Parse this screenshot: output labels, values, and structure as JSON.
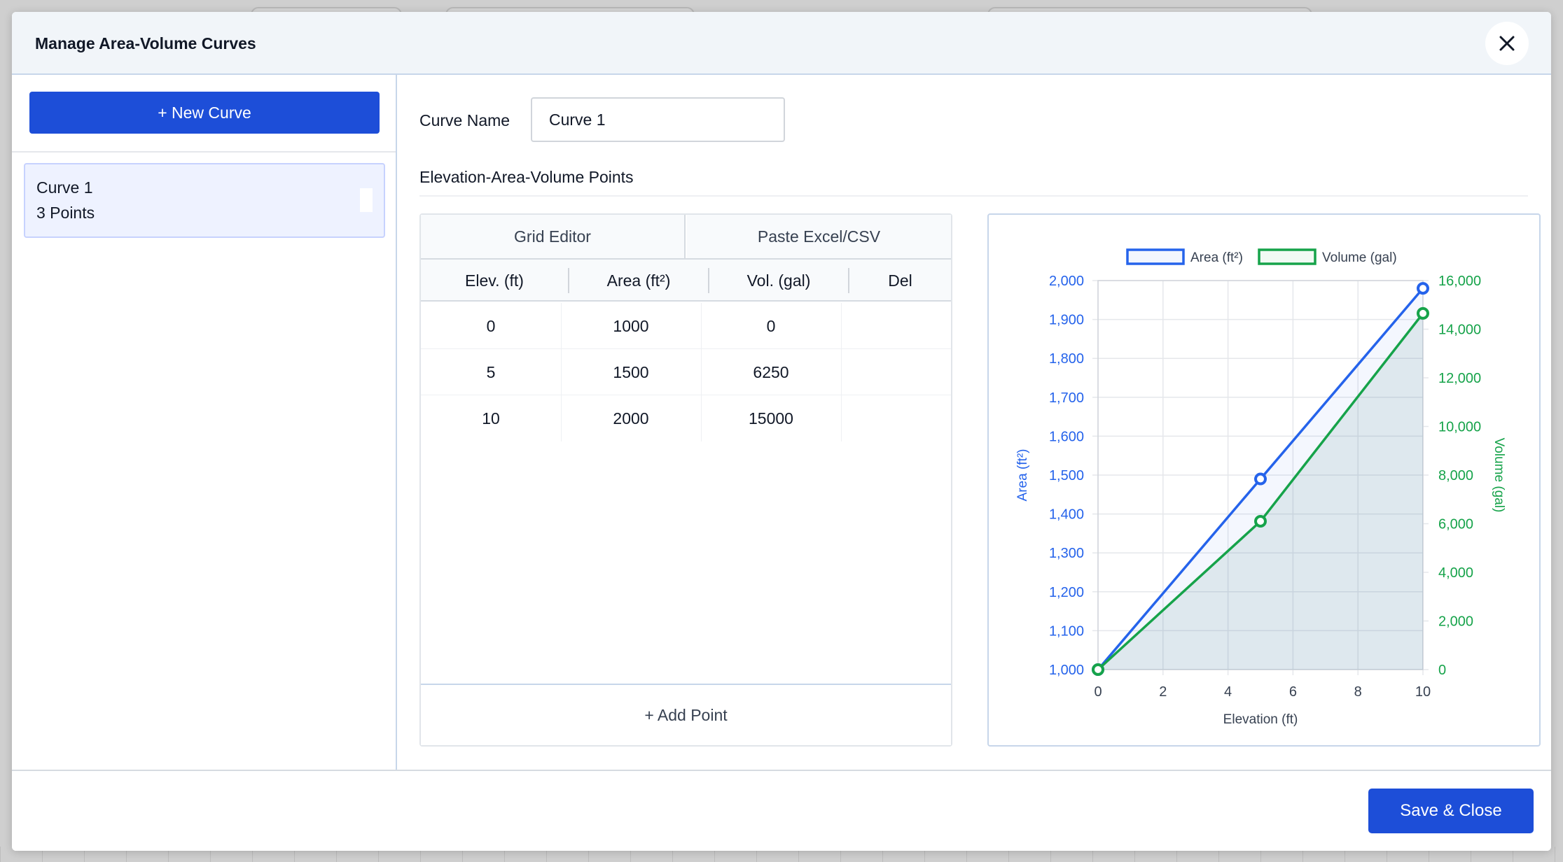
{
  "modal": {
    "title": "Manage Area-Volume Curves"
  },
  "sidebar": {
    "new_curve_label": "+ New Curve",
    "curves": [
      {
        "name": "Curve 1",
        "points_label": "3 Points"
      }
    ]
  },
  "editor": {
    "curve_name_label": "Curve Name",
    "curve_name_value": "Curve 1",
    "section_title": "Elevation-Area-Volume Points",
    "tabs": [
      "Grid Editor",
      "Paste Excel/CSV"
    ],
    "columns": [
      "Elev. (ft)",
      "Area (ft²)",
      "Vol. (gal)",
      "Del"
    ],
    "rows": [
      [
        "0",
        "1000",
        "0"
      ],
      [
        "5",
        "1500",
        "6250"
      ],
      [
        "10",
        "2000",
        "15000"
      ]
    ],
    "add_point_label": "+ Add Point"
  },
  "footer": {
    "save_label": "Save & Close"
  },
  "icons": {
    "close": "close-icon"
  },
  "colors": {
    "primary": "#1d4ed8",
    "area_series": "#2563eb",
    "volume_series": "#16a34a"
  },
  "chart_data": {
    "type": "line",
    "x": [
      0,
      5,
      10
    ],
    "xlabel": "Elevation (ft)",
    "x_ticks": [
      "0",
      "2",
      "4",
      "6",
      "8",
      "10"
    ],
    "xlim": [
      0,
      10
    ],
    "series": [
      {
        "name": "Area (ft²)",
        "axis": "left",
        "values": [
          1000,
          1490,
          1980
        ],
        "color": "#2563eb"
      },
      {
        "name": "Volume (gal)",
        "axis": "right",
        "values": [
          0,
          6100,
          14650
        ],
        "color": "#16a34a",
        "fill": true
      }
    ],
    "ylabel_left": "Area (ft²)",
    "ylim_left": [
      1000,
      2000
    ],
    "y_ticks_left": [
      "1,000",
      "1,100",
      "1,200",
      "1,300",
      "1,400",
      "1,500",
      "1,600",
      "1,700",
      "1,800",
      "1,900",
      "2,000"
    ],
    "ylabel_right": "Volume (gal)",
    "ylim_right": [
      0,
      16000
    ],
    "y_ticks_right": [
      "0",
      "2,000",
      "4,000",
      "6,000",
      "8,000",
      "10,000",
      "12,000",
      "14,000",
      "16,000"
    ],
    "grid": true,
    "legend": "top-center"
  }
}
